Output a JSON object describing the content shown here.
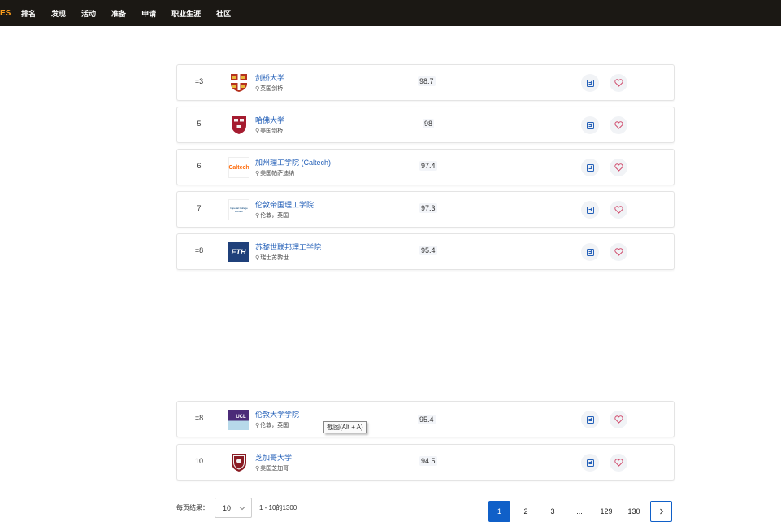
{
  "header": {
    "brand": "ES",
    "nav": [
      "排名",
      "发现",
      "活动",
      "准备",
      "申请",
      "职业生涯",
      "社区"
    ]
  },
  "rows": [
    {
      "rank": "=3",
      "name": "剑桥大学",
      "location": "英国剑桥",
      "score": "98.7",
      "logo": "cambridge-crest-icon"
    },
    {
      "rank": "5",
      "name": "哈佛大学",
      "location": "美国剑桥",
      "score": "98",
      "logo": "harvard-shield-icon"
    },
    {
      "rank": "6",
      "name": "加州理工学院 (Caltech)",
      "location": "美国帕萨迪纳",
      "score": "97.4",
      "logo": "caltech-logo",
      "logo_text": "Caltech"
    },
    {
      "rank": "7",
      "name": "伦敦帝国理工学院",
      "location": "伦敦，英国",
      "score": "97.3",
      "logo": "imperial-logo",
      "logo_text": "Imperial College London"
    },
    {
      "rank": "=8",
      "name": "苏黎世联邦理工学院",
      "location": "瑞士苏黎世",
      "score": "95.4",
      "logo": "eth-logo",
      "logo_text": "ETH"
    },
    {
      "rank": "=8",
      "name": "伦敦大学学院",
      "location": "伦敦，英国",
      "score": "95.4",
      "logo": "ucl-logo",
      "logo_text": "UCL"
    },
    {
      "rank": "10",
      "name": "芝加哥大学",
      "location": "美国芝加哥",
      "score": "94.5",
      "logo": "chicago-shield-icon"
    }
  ],
  "tooltip": "截图(Alt + A)",
  "pagination": {
    "per_page_label": "每页结果：",
    "per_page_value": "10",
    "range_text": "1 - 10的1300",
    "pages": [
      "1",
      "2",
      "3",
      "...",
      "129",
      "130"
    ]
  },
  "colors": {
    "topbar": "#1b1814",
    "brand": "#ff9f1c",
    "link": "#2460b8",
    "active_page": "#1060c8"
  }
}
